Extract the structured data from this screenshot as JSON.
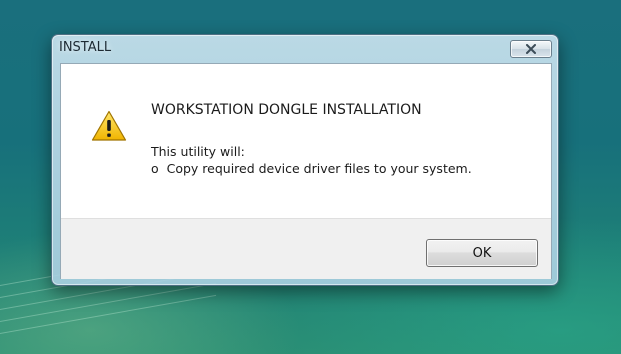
{
  "dialog": {
    "title": "INSTALL",
    "heading": "WORKSTATION DONGLE INSTALLATION",
    "intro": "This utility will:",
    "bullet": "o  Copy required device driver files to your system.",
    "ok_label": "OK",
    "close_icon": "close-icon",
    "message_icon": "warning-icon"
  },
  "colors": {
    "desktop": "#1a6f7d",
    "warning_fill": "#f6c200",
    "dialog_bg": "#ffffff",
    "footer_bg": "#f0f0f0"
  }
}
